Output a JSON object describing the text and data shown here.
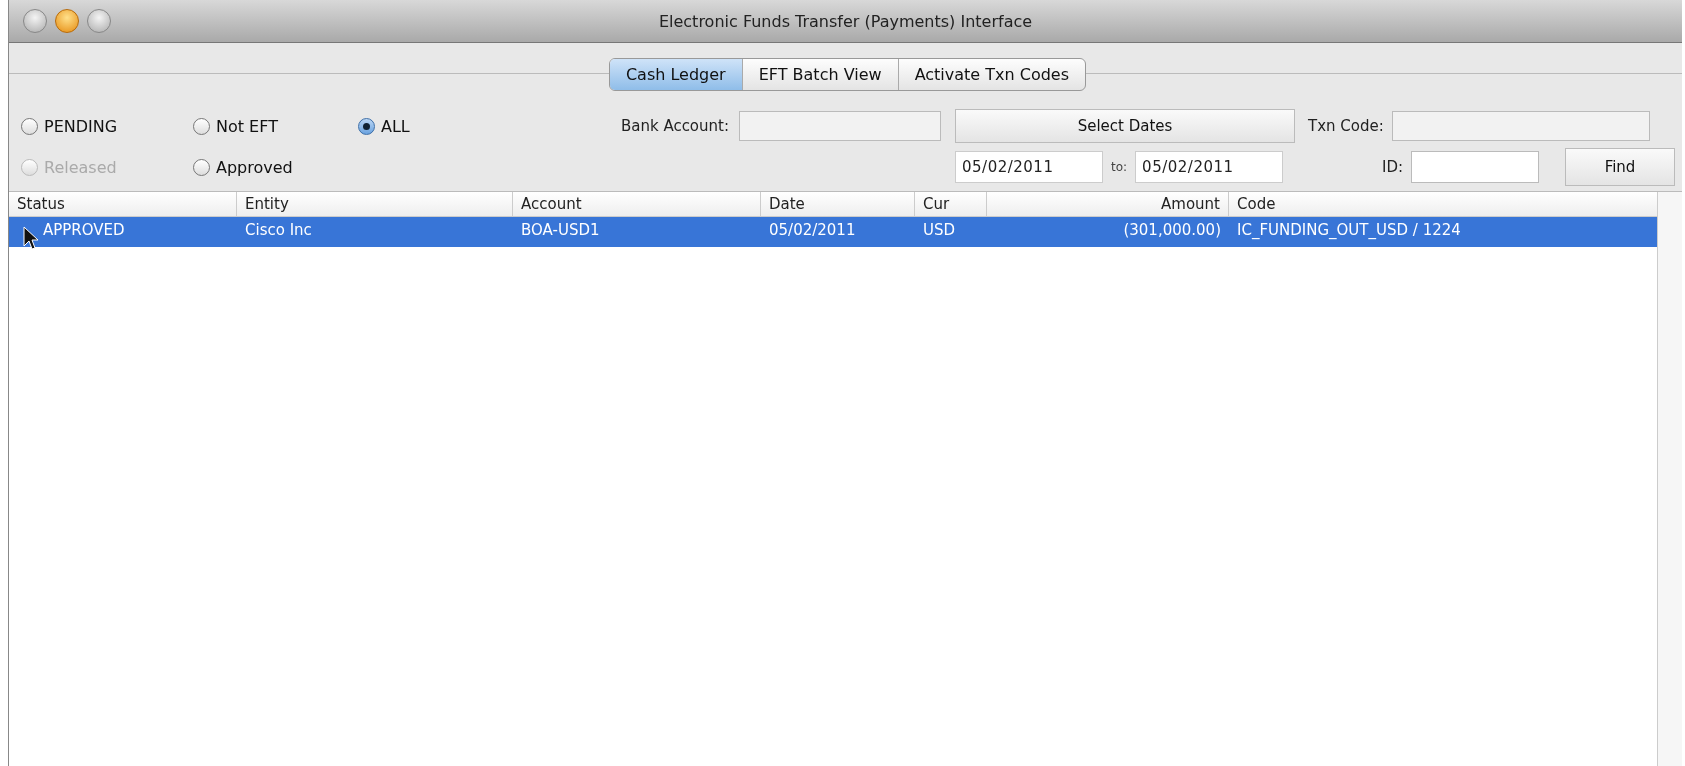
{
  "window": {
    "title": "Electronic Funds Transfer (Payments) Interface"
  },
  "tabs": [
    {
      "label": "Cash Ledger",
      "selected": true
    },
    {
      "label": "EFT Batch View",
      "selected": false
    },
    {
      "label": "Activate Txn Codes",
      "selected": false
    }
  ],
  "filters": {
    "radios": [
      {
        "label": "PENDING",
        "selected": false,
        "disabled": false
      },
      {
        "label": "Not EFT",
        "selected": false,
        "disabled": false
      },
      {
        "label": "ALL",
        "selected": true,
        "disabled": false
      },
      {
        "label": "Released",
        "selected": false,
        "disabled": true
      },
      {
        "label": "Approved",
        "selected": false,
        "disabled": false
      }
    ],
    "bank_account": {
      "label": "Bank Account:"
    },
    "select_dates_button": "Select Dates",
    "date_from": "05/02/2011",
    "date_to_label": "to:",
    "date_to": "05/02/2011",
    "txn_code": {
      "label": "Txn Code:"
    },
    "id": {
      "label": "ID:"
    },
    "find_button": "Find"
  },
  "table": {
    "columns": [
      {
        "label": "Status"
      },
      {
        "label": "Entity"
      },
      {
        "label": "Account"
      },
      {
        "label": "Date"
      },
      {
        "label": "Cur"
      },
      {
        "label": "Amount"
      },
      {
        "label": "Code"
      }
    ],
    "rows": [
      {
        "selected": true,
        "cells": [
          "APPROVED",
          "Cisco Inc",
          "BOA-USD1",
          "05/02/2011",
          "USD",
          "(301,000.00)",
          "IC_FUNDING_OUT_USD / 1224"
        ]
      }
    ]
  }
}
